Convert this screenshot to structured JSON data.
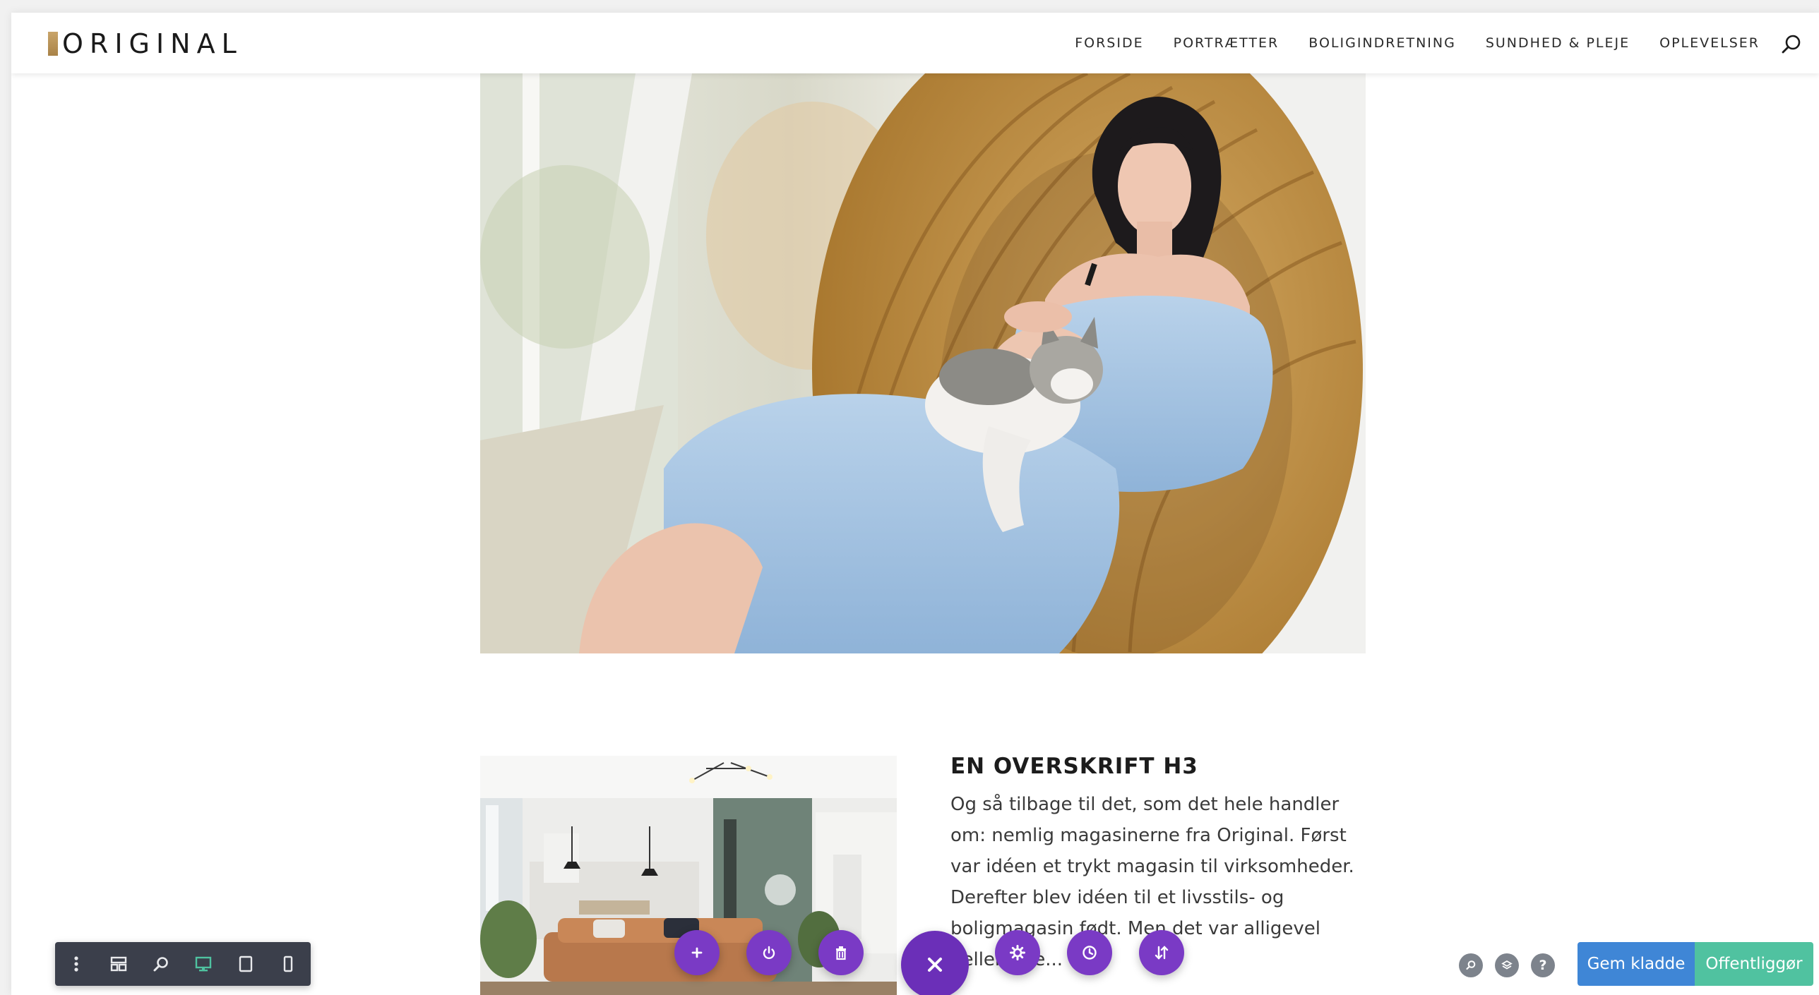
{
  "site": {
    "logo_text": "ORIGINAL"
  },
  "nav": {
    "items": [
      "FORSIDE",
      "PORTRÆTTER",
      "BOLIGINDRETNING",
      "SUNDHED & PLEJE",
      "OPLEVELSER"
    ]
  },
  "icons": {
    "search": "search-icon",
    "toolbar": [
      "more-vertical-icon",
      "layout-icon",
      "zoom-icon",
      "desktop-icon",
      "tablet-icon",
      "phone-icon"
    ],
    "actions": [
      "plus-icon",
      "power-icon",
      "trash-icon",
      "close-icon",
      "gear-icon",
      "history-icon",
      "sort-icon"
    ],
    "mini": [
      "search-icon",
      "layers-icon",
      "help-icon"
    ]
  },
  "article": {
    "heading": "EN OVERSKRIFT H3",
    "body": "Og så tilbage til det, som det hele handler om: nemlig magasinerne fra Original. Først var idéen et trykt magasin til virksomheder. Derefter blev idéen til et livsstils- og boligmagasin født. Men det var alligevel heller ikke..."
  },
  "builder": {
    "help_label": "?",
    "save_draft": "Gem kladde",
    "publish": "Offentliggør"
  },
  "colors": {
    "purple": "#7a3ac5",
    "draft_blue": "#3f86d6",
    "publish_green": "#50c2a0",
    "toolbar_dark": "#3b3f4b"
  }
}
